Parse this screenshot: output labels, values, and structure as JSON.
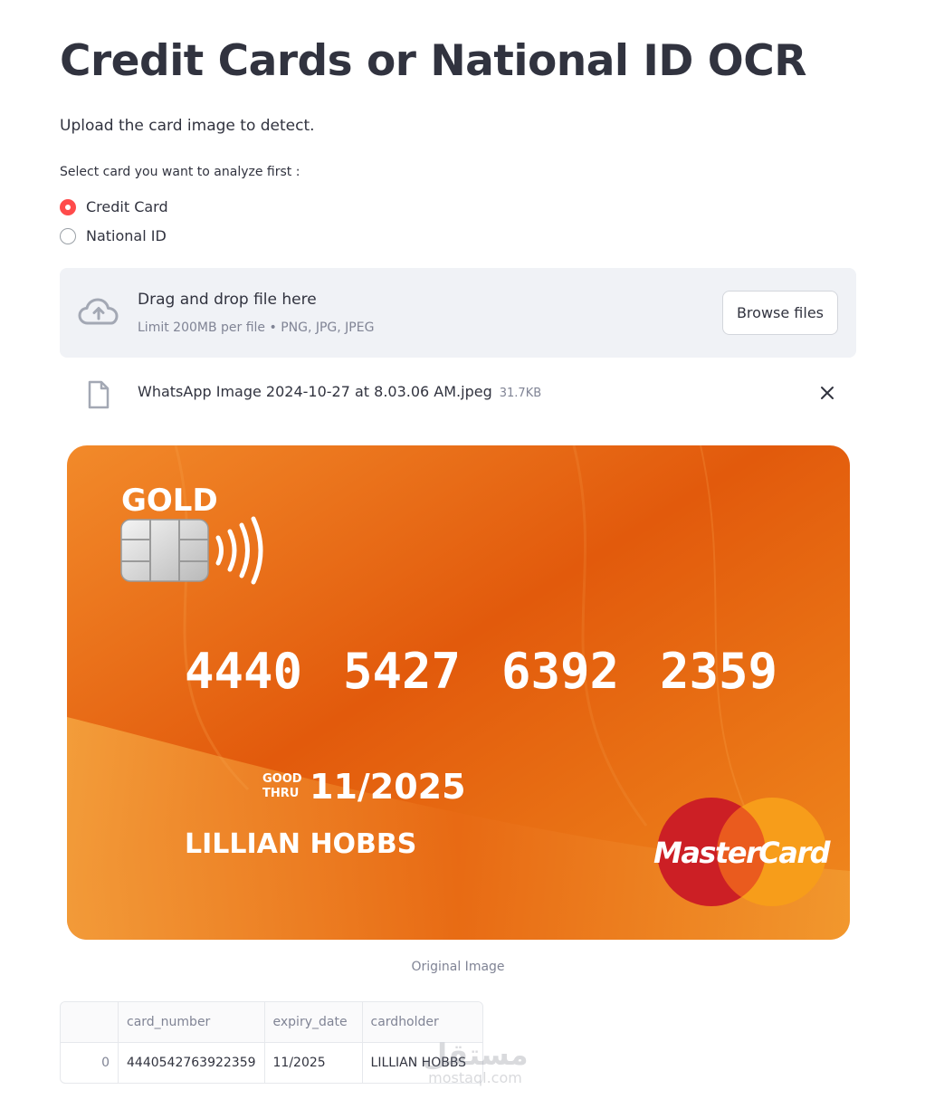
{
  "header": {
    "title": "Credit Cards or National ID OCR",
    "subtitle": "Upload the card image to detect."
  },
  "card_type_selector": {
    "label": "Select card you want to analyze first :",
    "options": [
      {
        "label": "Credit Card",
        "selected": true
      },
      {
        "label": "National ID",
        "selected": false
      }
    ]
  },
  "uploader": {
    "drag_text": "Drag and drop file here",
    "limit_text": "Limit 200MB per file • PNG, JPG, JPEG",
    "browse_label": "Browse files",
    "icon": "cloud-upload-icon"
  },
  "uploaded_file": {
    "name": "WhatsApp Image 2024-10-27 at 8.03.06 AM.jpeg",
    "size": "31.7KB",
    "icon": "file-icon"
  },
  "image": {
    "caption": "Original Image",
    "card": {
      "tier": "GOLD",
      "number_groups": [
        "4440",
        "5427",
        "6392",
        "2359"
      ],
      "good_thru_top": "GOOD",
      "good_thru_bottom": "THRU",
      "expiry": "11/2025",
      "holder": "LILLIAN HOBBS",
      "brand": "MasterCard"
    }
  },
  "results_table": {
    "columns": [
      "",
      "card_number",
      "expiry_date",
      "cardholder"
    ],
    "rows": [
      {
        "index": "0",
        "card_number": "4440542763922359",
        "expiry_date": "11/2025",
        "cardholder": "LILLIAN HOBBS"
      }
    ]
  },
  "watermark": {
    "arabic": "مستقل",
    "latin": "mostaql.com"
  },
  "colors": {
    "accent": "#ff4b4b",
    "text": "#31333f",
    "muted": "#808495",
    "uploader_bg": "#f0f2f6",
    "card_orange": "#ee6a10"
  }
}
